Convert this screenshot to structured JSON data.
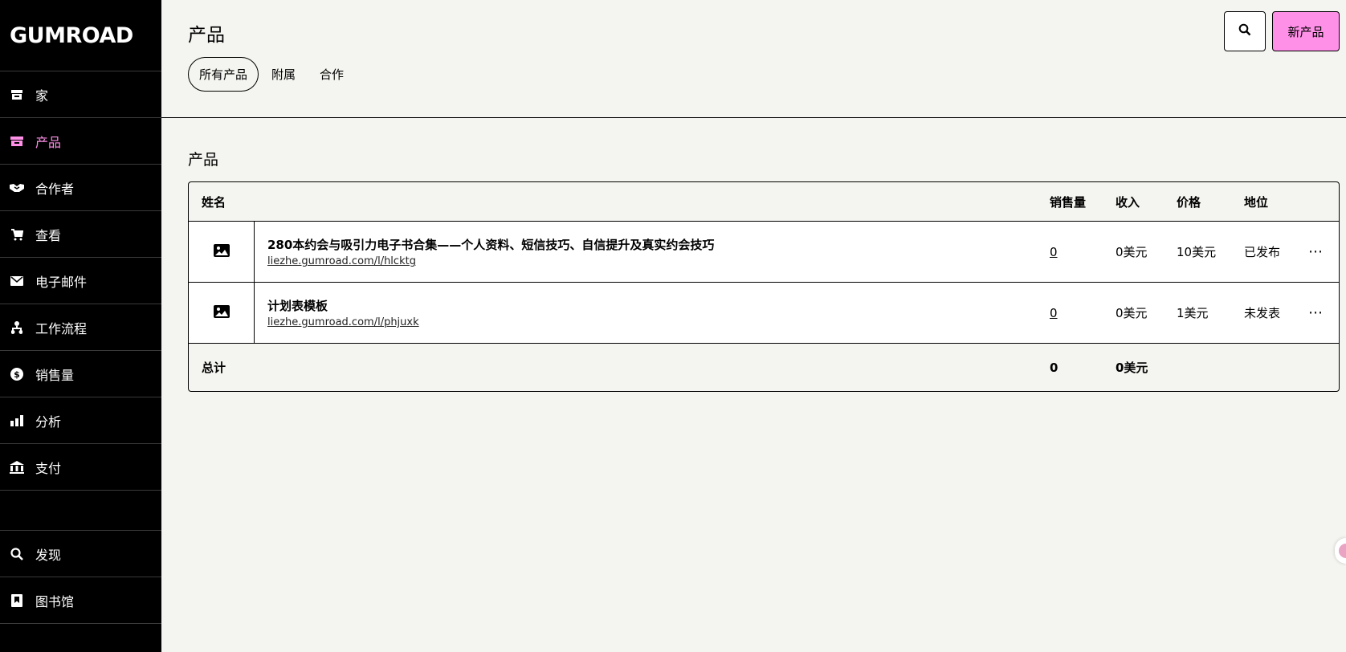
{
  "sidebar": {
    "logo": "GUMROAD",
    "items": [
      {
        "label": "家",
        "icon": "shop-icon"
      },
      {
        "label": "产品",
        "icon": "archive-icon",
        "active": true
      },
      {
        "label": "合作者",
        "icon": "handshake-icon"
      },
      {
        "label": "查看",
        "icon": "cart-icon"
      },
      {
        "label": "电子邮件",
        "icon": "envelope-icon"
      },
      {
        "label": "工作流程",
        "icon": "workflow-icon"
      },
      {
        "label": "销售量",
        "icon": "dollar-icon"
      },
      {
        "label": "分析",
        "icon": "bar-chart-icon"
      },
      {
        "label": "支付",
        "icon": "bank-icon"
      }
    ],
    "bottom_items": [
      {
        "label": "发现",
        "icon": "search-icon"
      },
      {
        "label": "图书馆",
        "icon": "bookmark-icon"
      }
    ]
  },
  "header": {
    "title": "产品",
    "tabs": [
      "所有产品",
      "附属",
      "合作"
    ],
    "new_product_label": "新产品"
  },
  "main": {
    "section_title": "产品",
    "table": {
      "columns": {
        "name": "姓名",
        "sales": "销售量",
        "revenue": "收入",
        "price": "价格",
        "status": "地位"
      },
      "rows": [
        {
          "name": "280本约会与吸引力电子书合集——个人资料、短信技巧、自信提升及真实约会技巧",
          "url": "liezhe.gumroad.com/l/hlcktg",
          "sales": "0",
          "revenue": "0美元",
          "price": "10美元",
          "status": "已发布"
        },
        {
          "name": "计划表模板",
          "url": "liezhe.gumroad.com/l/phjuxk",
          "sales": "0",
          "revenue": "0美元",
          "price": "1美元",
          "status": "未发表"
        }
      ],
      "footer": {
        "label": "总计",
        "sales": "0",
        "revenue": "0美元"
      }
    }
  },
  "colors": {
    "accent_pink": "#ff90e8",
    "sidebar_bg": "#000000",
    "page_bg": "#f4f4f0"
  }
}
